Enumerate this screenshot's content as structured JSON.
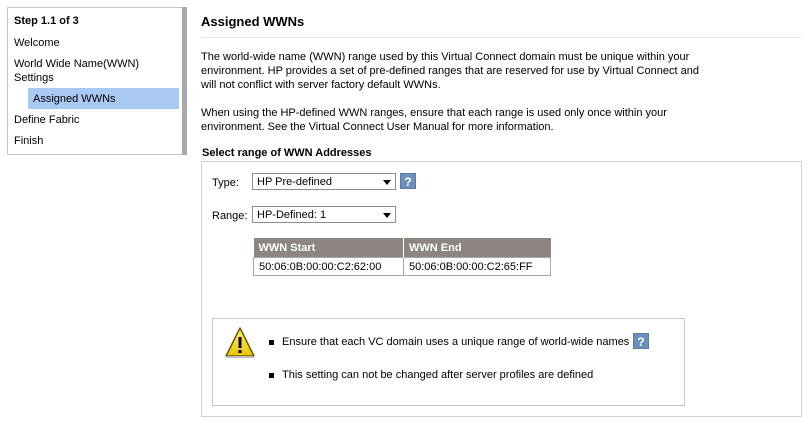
{
  "nav": {
    "step": "Step 1.1 of 3",
    "items": [
      {
        "label": "Welcome"
      },
      {
        "label": "World Wide Name(WWN)"
      },
      {
        "label": "Settings"
      },
      {
        "label": "Assigned WWNs"
      },
      {
        "label": "Define Fabric"
      },
      {
        "label": "Finish"
      }
    ],
    "selected_color": "#a9c9f2"
  },
  "main": {
    "title": "Assigned WWNs",
    "paragraph1": [
      "The world-wide name (WWN) range used by this Virtual Connect domain must be unique within your",
      "environment. HP provides a set of pre-defined ranges that are reserved for use by Virtual Connect and",
      "will not conflict with server factory default WWNs."
    ],
    "paragraph2": [
      "When using the HP-defined WWN ranges, ensure that each range is used only once within your",
      "environment. See the Virtual Connect User Manual for more information."
    ],
    "section_title": "Select range of WWN Addresses",
    "type_label": "Type:",
    "type_value": "HP Pre-defined",
    "range_label": "Range:",
    "range_value": "HP-Defined: 1",
    "help_glyph": "?",
    "table": {
      "headers": [
        "WWN Start",
        "WWN End"
      ],
      "rows": [
        [
          "50:06:0B:00:00:C2:62:00",
          "50:06:0B:00:00:C2:65:FF"
        ]
      ],
      "header_color": "#8c8581"
    },
    "warnings": [
      "Ensure that each VC domain uses a unique range of world-wide names",
      "This setting can not be changed after server profiles are defined"
    ],
    "icons": {
      "warning": "warning-icon",
      "help": "help-icon",
      "dropdown": "chevron-down-icon"
    }
  }
}
